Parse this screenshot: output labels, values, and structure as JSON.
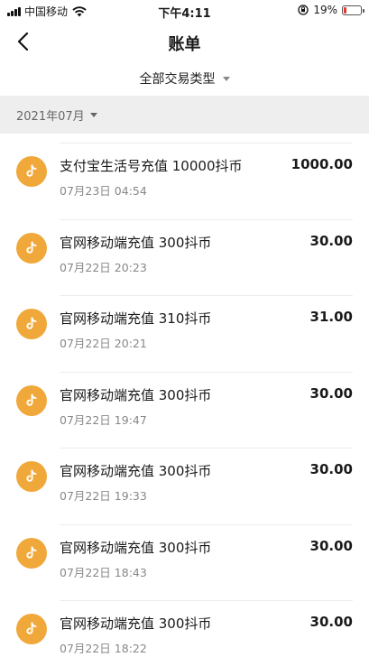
{
  "status_bar": {
    "carrier": "中国移动",
    "time": "下午4:11",
    "battery": "19%",
    "battery_level": 0.19
  },
  "header": {
    "title": "账单",
    "back_icon": "chevron-left-icon"
  },
  "filter": {
    "label": "全部交易类型"
  },
  "month": {
    "label": "2021年07月"
  },
  "transactions": [
    {
      "title": "支付宝生活号充值 10000抖币",
      "date": "07月23日 04:54",
      "amount": "1000.00",
      "icon": "douyin-icon"
    },
    {
      "title": "官网移动端充值 300抖币",
      "date": "07月22日 20:23",
      "amount": "30.00",
      "icon": "douyin-icon"
    },
    {
      "title": "官网移动端充值 310抖币",
      "date": "07月22日 20:21",
      "amount": "31.00",
      "icon": "douyin-icon"
    },
    {
      "title": "官网移动端充值 300抖币",
      "date": "07月22日 19:47",
      "amount": "30.00",
      "icon": "douyin-icon"
    },
    {
      "title": "官网移动端充值 300抖币",
      "date": "07月22日 19:33",
      "amount": "30.00",
      "icon": "douyin-icon"
    },
    {
      "title": "官网移动端充值 300抖币",
      "date": "07月22日 18:43",
      "amount": "30.00",
      "icon": "douyin-icon"
    },
    {
      "title": "官网移动端充值 300抖币",
      "date": "07月22日 18:22",
      "amount": "30.00",
      "icon": "douyin-icon"
    }
  ],
  "colors": {
    "icon_bg": "#f0a83a",
    "section_bg": "#eeeeee",
    "battery_low": "#e53935"
  }
}
